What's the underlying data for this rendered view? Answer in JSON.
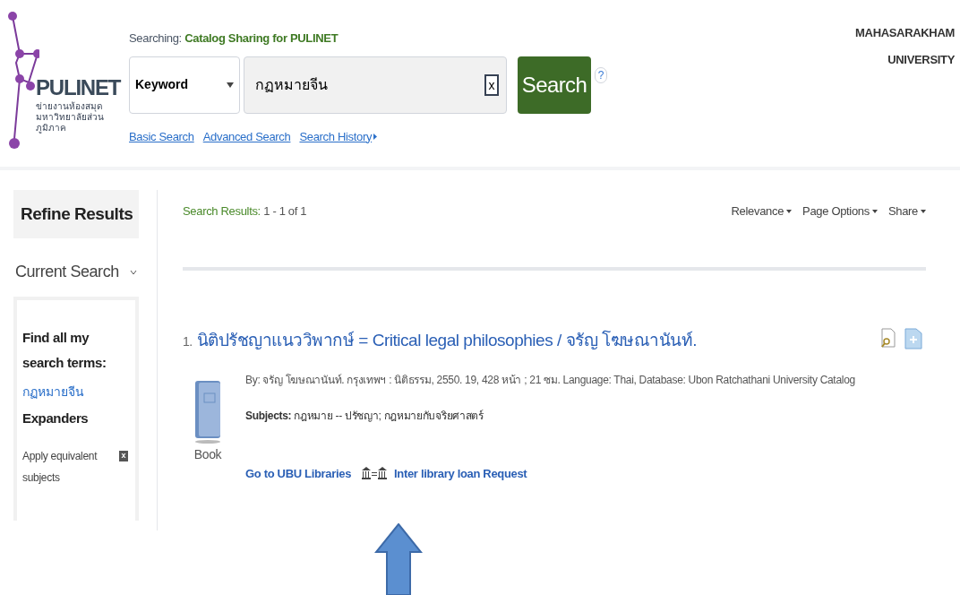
{
  "logo": {
    "name": "PULINET",
    "tagline": "ข่ายงานห้องสมุดมหาวิทยาลัยส่วนภูมิภาค"
  },
  "searching": {
    "label": "Searching:",
    "target": "Catalog Sharing for PULINET"
  },
  "search": {
    "field_type": "Keyword",
    "query": "กฏหมายจีน",
    "clear": "x",
    "button": "Search",
    "help": "?"
  },
  "search_links": [
    {
      "label": "Basic Search",
      "kind": "link"
    },
    {
      "label": "Advanced Search",
      "kind": "link"
    },
    {
      "label": "Search History",
      "kind": "menu"
    }
  ],
  "institution": [
    "MAHASARAKHAM",
    "UNIVERSITY"
  ],
  "sidebar": {
    "title": "Refine Results",
    "current_search": {
      "title": "Current Search",
      "expanded": true,
      "find_all_label": "Find all my search terms:",
      "term": "กฏหมายจีน",
      "expanders_label": "Expanders",
      "expanders": [
        {
          "label": "Apply equivalent subjects",
          "remove": "x"
        }
      ]
    }
  },
  "results_header": {
    "count_label": "Search Results:",
    "count": "1 - 1 of 1",
    "menus": [
      "Relevance",
      "Page Options",
      "Share"
    ]
  },
  "results": [
    {
      "number": "1.",
      "title": "นิติปรัชญาแนววิพากษ์ = Critical legal philosophies / จรัญ โฆษณานันท์.",
      "type_label": "Book",
      "byline": "By: จรัญ โฆษณานันท์. กรุงเทพฯ : นิติธรรม, 2550. 19, 428 หน้า ; 21 ซม. Language: Thai, Database: Ubon Ratchathani University Catalog",
      "subjects_label": "Subjects:",
      "subjects": "กฎหมาย -- ปรัชญา; กฎหมายกับจริยศาสตร์",
      "links": [
        {
          "label": "Go to UBU Libraries",
          "kind": "plain"
        },
        {
          "label": "Inter library loan Request",
          "kind": "ill"
        }
      ]
    }
  ]
}
